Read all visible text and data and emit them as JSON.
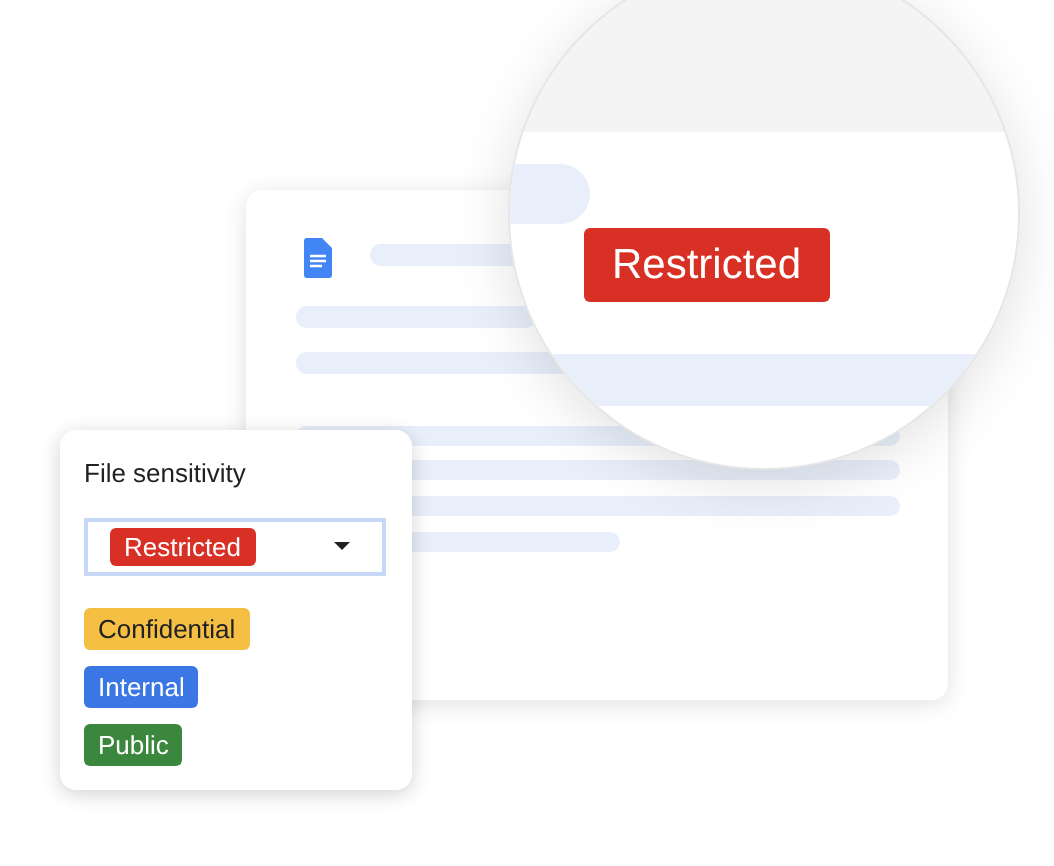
{
  "magnifier": {
    "label": "Restricted",
    "color": "#d93025"
  },
  "panel": {
    "title": "File sensitivity",
    "select": {
      "value": "Restricted",
      "color": "#d93025"
    },
    "options": [
      {
        "label": "Confidential",
        "color": "#f4bf42"
      },
      {
        "label": "Internal",
        "color": "#3a76e4"
      },
      {
        "label": "Public",
        "color": "#3b873e"
      }
    ]
  }
}
